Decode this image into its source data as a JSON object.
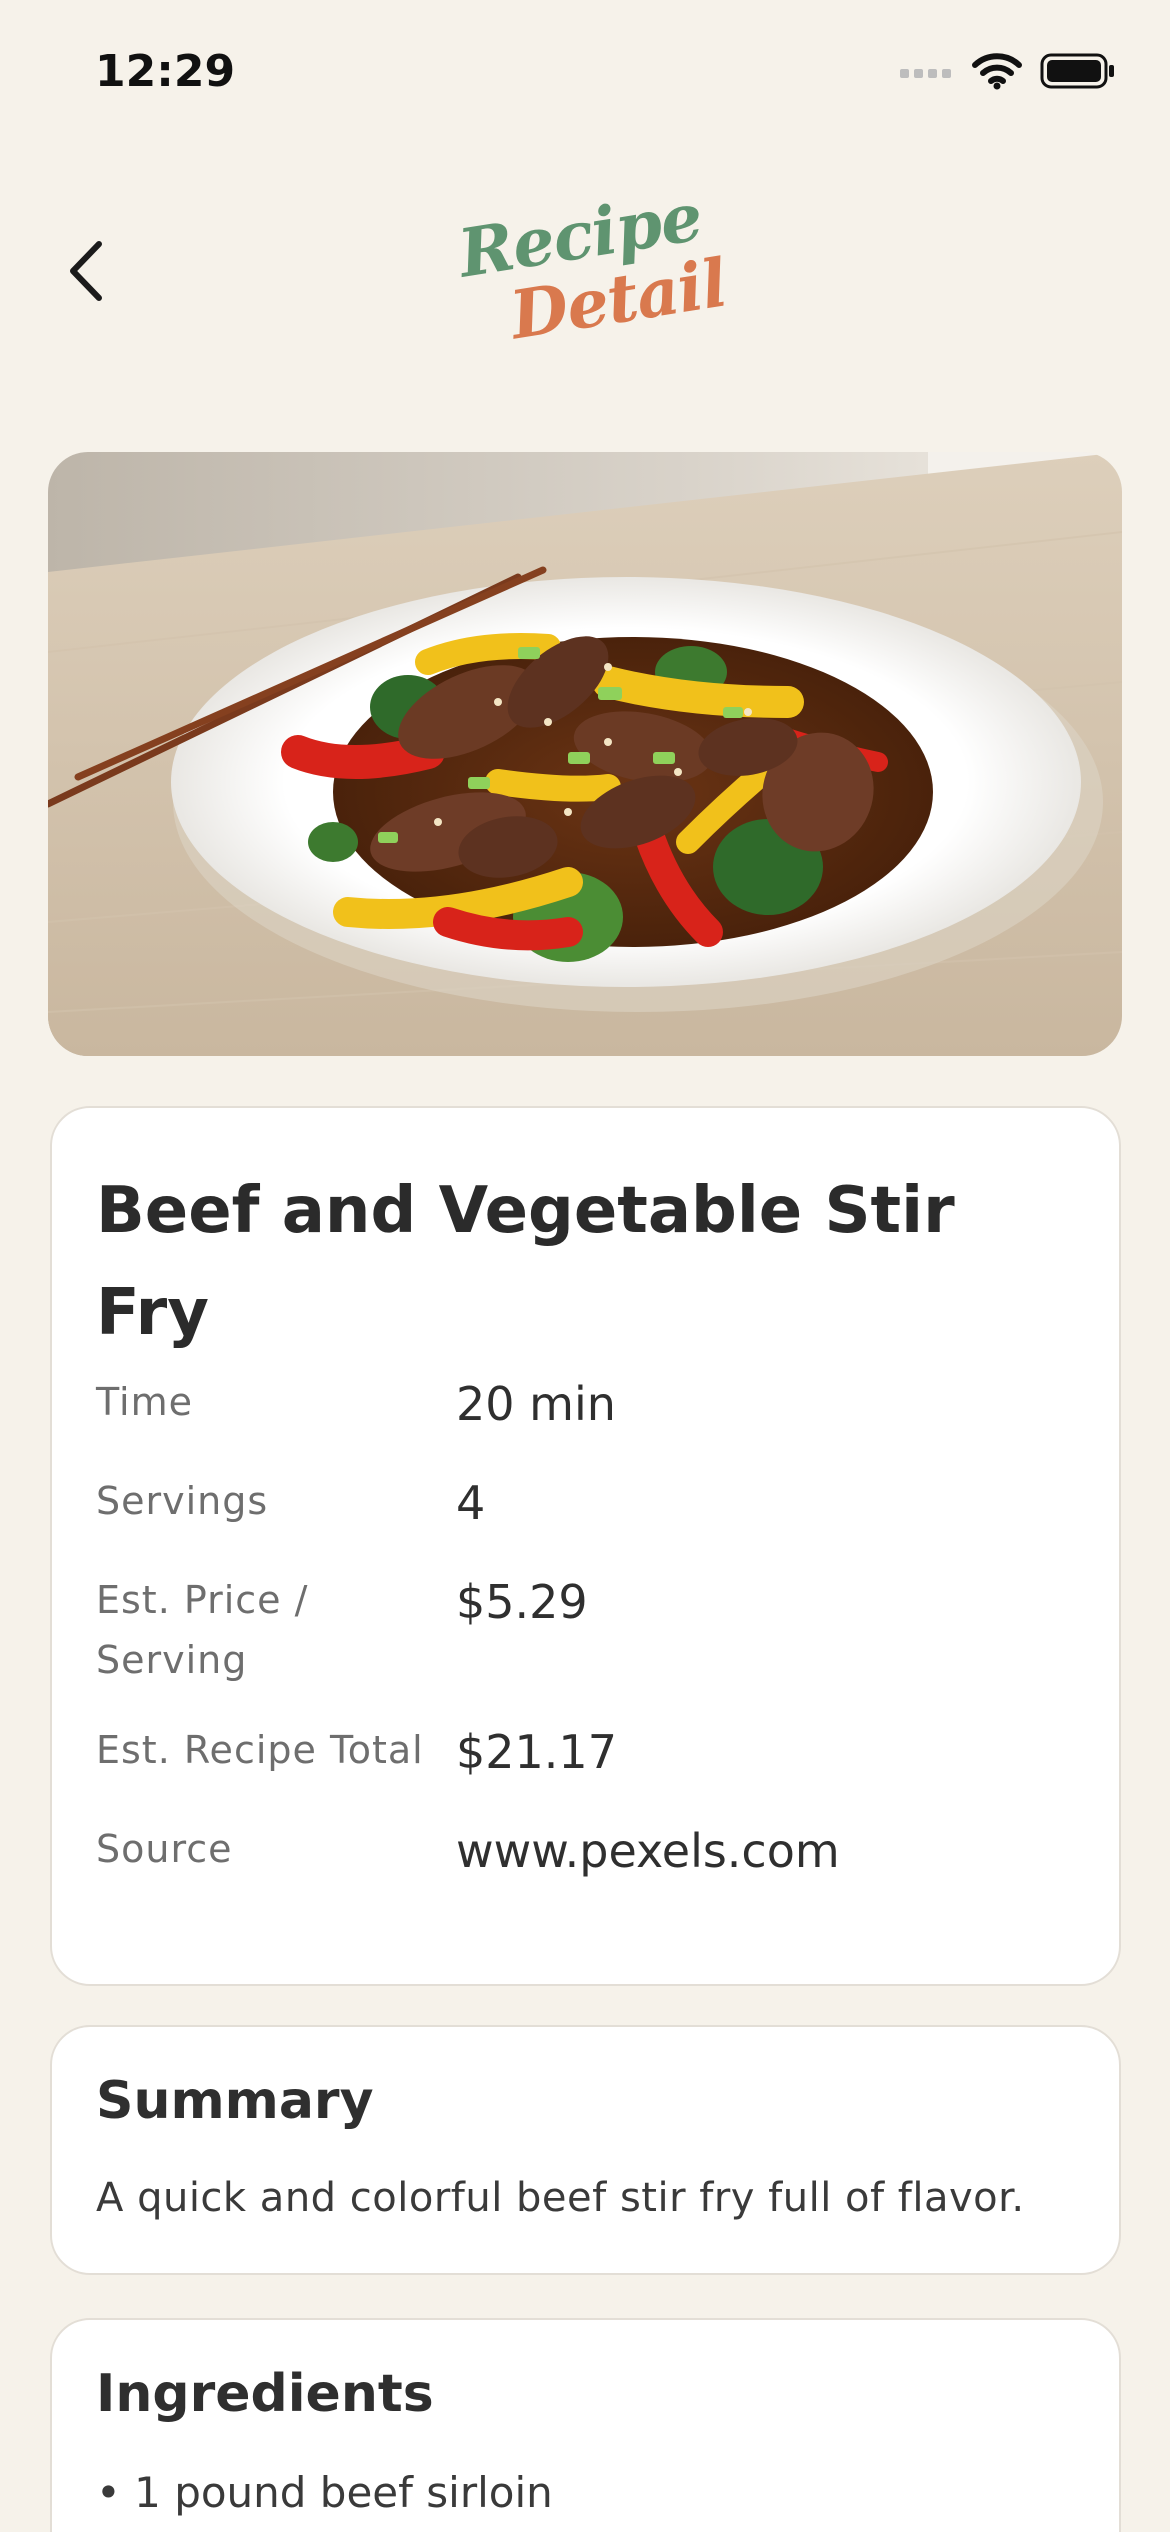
{
  "status_bar": {
    "time": "12:29"
  },
  "nav": {
    "logo_line1": "Recipe",
    "logo_line2": "Detail",
    "icons": {
      "back": "chevron-left-icon",
      "signal": "cellular-signal-icon",
      "wifi": "wifi-icon",
      "battery": "battery-icon"
    }
  },
  "hero": {
    "image": "beef-stir-fry-photo"
  },
  "recipe": {
    "title": "Beef and Vegetable Stir Fry",
    "details": [
      {
        "label": "Time",
        "value": "20 min"
      },
      {
        "label": "Servings",
        "value": "4"
      },
      {
        "label": "Est. Price / Serving",
        "value": "$5.29"
      },
      {
        "label": "Est. Recipe Total",
        "value": "$21.17"
      },
      {
        "label": "Source",
        "value": "www.pexels.com"
      }
    ]
  },
  "summary": {
    "heading": "Summary",
    "text": "A quick and colorful beef stir fry full of flavor."
  },
  "ingredients": {
    "heading": "Ingredients",
    "items": [
      "• 1 pound beef sirloin"
    ]
  },
  "colors": {
    "background": "#f6f2ea",
    "logo_green": "#5f9470",
    "logo_orange": "#d9794e",
    "card": "#ffffff"
  }
}
